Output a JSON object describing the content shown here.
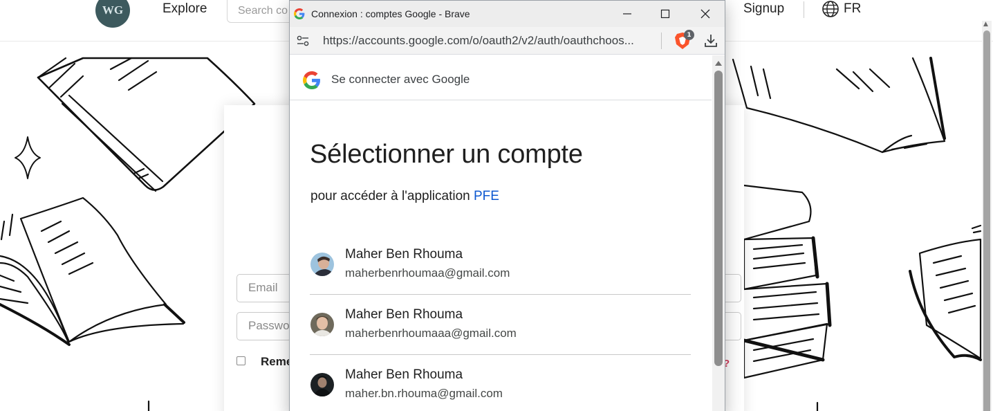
{
  "site": {
    "logo_text": "WG",
    "nav_explore": "Explore",
    "search_placeholder": "Search co",
    "nav_signup": "Signup",
    "language": "FR",
    "email_placeholder": "Email",
    "password_placeholder": "Passwo",
    "remember_label": "Reme",
    "question_mark": "?"
  },
  "popup": {
    "window_title": "Connexion : comptes Google - Brave",
    "url": "https://accounts.google.com/o/oauth2/v2/auth/oauthchoos...",
    "shield_count": "1",
    "google_bar_title": "Se connecter avec Google",
    "heading": "Sélectionner un compte",
    "subheading_prefix": "pour accéder à l'application ",
    "app_name": "PFE",
    "accounts": [
      {
        "name": "Maher Ben Rhouma",
        "email": "maherbenrhoumaa@gmail.com"
      },
      {
        "name": "Maher Ben Rhouma",
        "email": "maherbenrhoumaaa@gmail.com"
      },
      {
        "name": "Maher Ben Rhouma",
        "email": "maher.bn.rhouma@gmail.com"
      }
    ]
  },
  "colors": {
    "link_blue": "#0b57d0",
    "brave_orange": "#fb542b",
    "logo_teal": "#3d5a5e"
  }
}
